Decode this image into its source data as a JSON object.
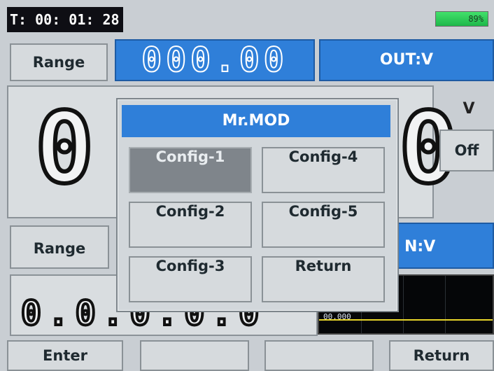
{
  "status": {
    "timer": "T: 00: 01: 28",
    "battery": "89%"
  },
  "main": {
    "range_top_label": "Range",
    "top_readout": "000.00",
    "out_label": "OUT:V",
    "big_digit_left": "0",
    "big_digit_right": "0",
    "unit_label": "V",
    "off_label": "Off",
    "range_bottom_label": "Range",
    "in_label": "N:V",
    "lower_readout": "0.0.0.0.0",
    "plot_value": "00.000"
  },
  "dialog": {
    "title": "Mr.MOD",
    "options": [
      "Config-1",
      "Config-4",
      "Config-2",
      "Config-5",
      "Config-3",
      "Return"
    ],
    "selected": "Config-1"
  },
  "bottom_bar": {
    "button1": "Enter",
    "button2": "",
    "button3": "",
    "button4": "Return"
  },
  "colors": {
    "accent_blue": "#2f7fd9",
    "battery_green": "#1db84a"
  }
}
